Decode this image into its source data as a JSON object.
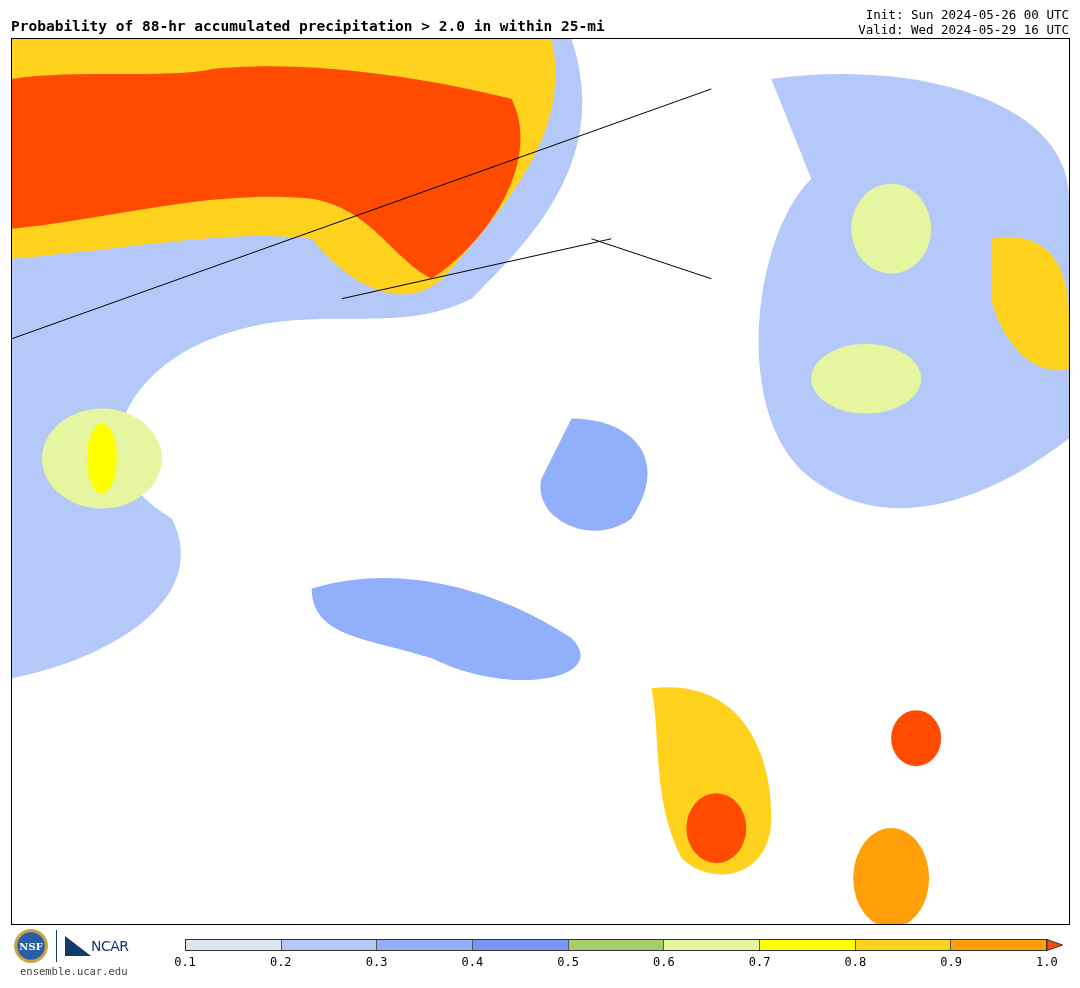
{
  "title": "Probability of 88-hr accumulated precipitation > 2.0 in within 25-mi",
  "init": "Init: Sun 2024-05-26 00 UTC",
  "valid": "Valid: Wed 2024-05-29 16 UTC",
  "logos": {
    "nsf": "NSF",
    "ncar": "NCAR",
    "site": "ensemble.ucar.edu"
  },
  "legend": {
    "segments": [
      {
        "color": "#dde6f0"
      },
      {
        "color": "#b4c8fa"
      },
      {
        "color": "#91affa"
      },
      {
        "color": "#7896fa"
      },
      {
        "color": "#a5cd69"
      },
      {
        "color": "#e6f5a0"
      },
      {
        "color": "#ffff00"
      },
      {
        "color": "#ffd21e"
      },
      {
        "color": "#ffa00a"
      }
    ],
    "extension": {
      "color": "#ff4b00"
    },
    "ticks": [
      "0.1",
      "0.2",
      "0.3",
      "0.4",
      "0.5",
      "0.6",
      "0.7",
      "0.8",
      "0.9",
      "1.0"
    ]
  }
}
